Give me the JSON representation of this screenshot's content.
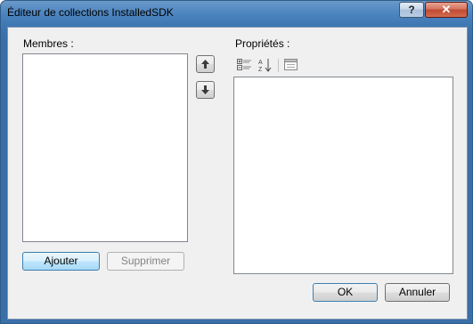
{
  "window": {
    "title": "Éditeur de collections InstalledSDK",
    "help_label": "?",
    "close_label": "✕"
  },
  "members": {
    "label": "Membres :",
    "items": [],
    "add_label": "Ajouter",
    "remove_label": "Supprimer"
  },
  "order_buttons": {
    "move_up_icon": "arrow-up-icon",
    "move_down_icon": "arrow-down-icon"
  },
  "properties": {
    "label": "Propriétés :",
    "toolbar": [
      "categorized-icon",
      "alphabetical-icon",
      "property-pages-icon"
    ]
  },
  "footer": {
    "ok_label": "OK",
    "cancel_label": "Annuler"
  }
}
